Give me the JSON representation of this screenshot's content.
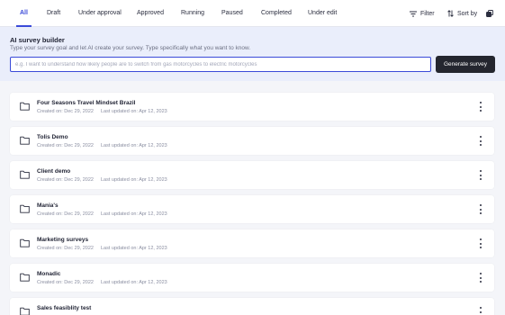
{
  "tabs": [
    {
      "label": "All",
      "active": true
    },
    {
      "label": "Draft"
    },
    {
      "label": "Under approval"
    },
    {
      "label": "Approved"
    },
    {
      "label": "Running"
    },
    {
      "label": "Paused"
    },
    {
      "label": "Completed"
    },
    {
      "label": "Under edit"
    }
  ],
  "tools": {
    "filter_label": "Filter",
    "sort_label": "Sort by",
    "filter_icon": "filter-lines-icon",
    "sort_icon": "sort-arrows-icon",
    "view_icon": "stack-icon"
  },
  "builder": {
    "title": "AI survey builder",
    "subtitle": "Type your survey goal and let AI create your survey. Type specifically what you want to know.",
    "input_value": "",
    "input_placeholder": "e.g. I want to understand how likely people are to switch from gas motorcycles to electric motorcycles",
    "button_label": "Generate survey"
  },
  "surveys": [
    {
      "name": "Four Seasons Travel Mindset Brazil",
      "created": "Created on: Dec 29, 2022",
      "updated": "Last updated on: Apr 12, 2023"
    },
    {
      "name": "Tolis Demo",
      "created": "Created on: Dec 29, 2022",
      "updated": "Last updated on: Apr 12, 2023"
    },
    {
      "name": "Client demo",
      "created": "Created on: Dec 29, 2022",
      "updated": "Last updated on: Apr 12, 2023"
    },
    {
      "name": "Mania's",
      "created": "Created on: Dec 29, 2022",
      "updated": "Last updated on: Apr 12, 2023"
    },
    {
      "name": "Marketing surveys",
      "created": "Created on: Dec 29, 2022",
      "updated": "Last updated on: Apr 12, 2023"
    },
    {
      "name": "Monadic",
      "created": "Created on: Dec 29, 2022",
      "updated": "Last updated on: Apr 12, 2023"
    },
    {
      "name": "Sales feasiblity test",
      "created": "",
      "updated": ""
    }
  ],
  "colors": {
    "accent": "#3a4ad8",
    "builder_bg": "#eaeefb",
    "page_bg": "#f4f5f9",
    "button_bg": "#24262f"
  }
}
